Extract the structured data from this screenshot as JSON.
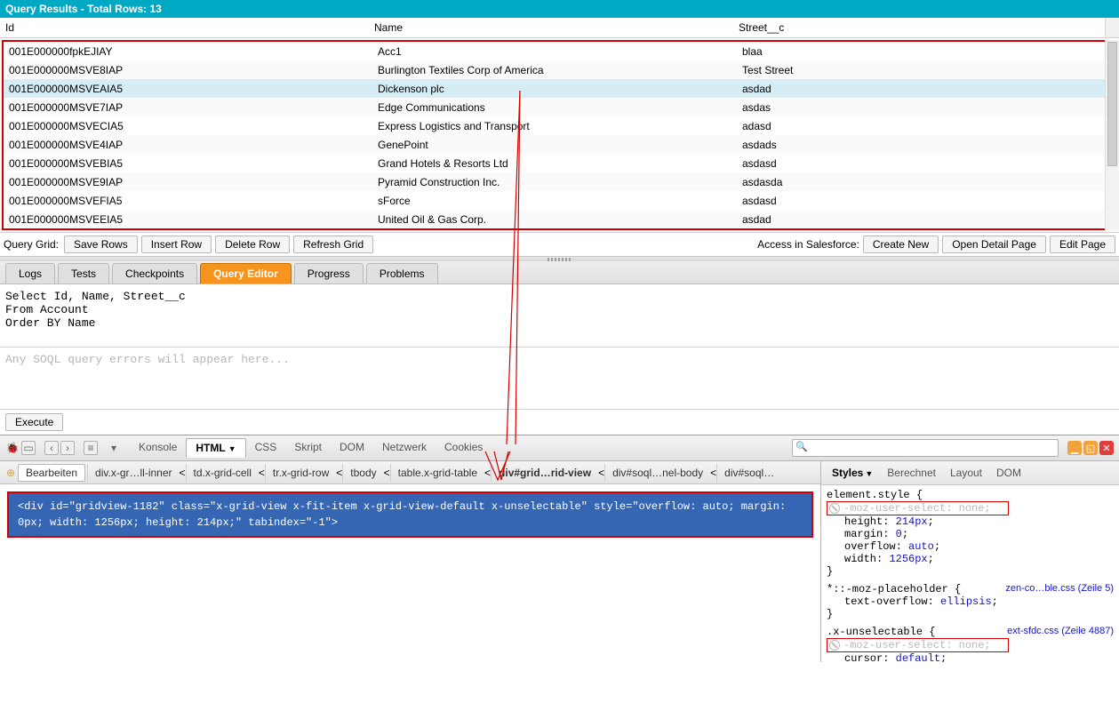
{
  "header": {
    "title": "Query Results - Total Rows: 13"
  },
  "columns": {
    "id": "Id",
    "name": "Name",
    "street": "Street__c"
  },
  "rows": [
    {
      "id": "001E000000fpkEJIAY",
      "name": "Acc1",
      "street": "blaa"
    },
    {
      "id": "001E000000MSVE8IAP",
      "name": "Burlington Textiles Corp of America",
      "street": "Test Street"
    },
    {
      "id": "001E000000MSVEAIA5",
      "name": "Dickenson plc",
      "street": "asdad",
      "selected": true
    },
    {
      "id": "001E000000MSVE7IAP",
      "name": "Edge Communications",
      "street": "asdas"
    },
    {
      "id": "001E000000MSVECIA5",
      "name": "Express Logistics and Transport",
      "street": "adasd"
    },
    {
      "id": "001E000000MSVE4IAP",
      "name": "GenePoint",
      "street": "asdads"
    },
    {
      "id": "001E000000MSVEBIA5",
      "name": "Grand Hotels & Resorts Ltd",
      "street": "asdasd"
    },
    {
      "id": "001E000000MSVE9IAP",
      "name": "Pyramid Construction Inc.",
      "street": "asdasda"
    },
    {
      "id": "001E000000MSVEFIA5",
      "name": "sForce",
      "street": "asdasd"
    },
    {
      "id": "001E000000MSVEEIA5",
      "name": "United Oil & Gas Corp.",
      "street": "asdad"
    }
  ],
  "toolbar": {
    "label": "Query Grid:",
    "save": "Save Rows",
    "insert": "Insert Row",
    "delete": "Delete Row",
    "refresh": "Refresh Grid",
    "accessLabel": "Access in Salesforce:",
    "createNew": "Create New",
    "openDetail": "Open Detail Page",
    "editPage": "Edit Page"
  },
  "bottomTabs": {
    "logs": "Logs",
    "tests": "Tests",
    "checkpoints": "Checkpoints",
    "queryEditor": "Query Editor",
    "progress": "Progress",
    "problems": "Problems"
  },
  "editor": {
    "sql": "Select Id, Name, Street__c\nFrom Account\nOrder BY Name",
    "errorHint": "Any SOQL query errors will appear here...",
    "execute": "Execute"
  },
  "devtools": {
    "tabs": {
      "konsole": "Konsole",
      "html": "HTML",
      "css": "CSS",
      "skript": "Skript",
      "dom": "DOM",
      "netzwerk": "Netzwerk",
      "cookies": "Cookies"
    },
    "breadcrumb": {
      "edit": "Bearbeiten",
      "c1": "div.x-gr…ll-inner",
      "c2": "td.x-grid-cell",
      "c3": "tr.x-grid-row",
      "c4": "tbody",
      "c5": "table.x-grid-table",
      "c6": "div#grid…rid-view",
      "c7": "div#soql…nel-body",
      "c8": "div#soql…"
    },
    "htmlBlock": "<div id=\"gridview-1182\" class=\"x-grid-view x-fit-item x-grid-view-default x-unselectable\" style=\"overflow: auto; margin: 0px; width: 1256px; height: 214px;\" tabindex=\"-1\">",
    "stylesTabs": {
      "styles": "Styles",
      "berechnet": "Berechnet",
      "layout": "Layout",
      "dom": "DOM"
    },
    "rules": {
      "r0sel": "element.style {",
      "r0p0": "-moz-user-select: none;",
      "r0p1n": "height",
      "r0p1v": "214px",
      "r0p2n": "margin",
      "r0p2v": "0",
      "r0p3n": "overflow",
      "r0p3v": "auto",
      "r0p4n": "width",
      "r0p4v": "1256px",
      "r1sel": "*::-moz-placeholder {",
      "r1src": "zen-co…ble.css (Zeile 5)",
      "r1p0n": "text-overflow",
      "r1p0v": "ellipsis",
      "r2sel": ".x-unselectable {",
      "r2src": "ext-sfdc.css (Zeile 4887)",
      "r2p0": "-moz-user-select: none;",
      "r2p1n": "cursor",
      "r2p1v": "default"
    }
  }
}
